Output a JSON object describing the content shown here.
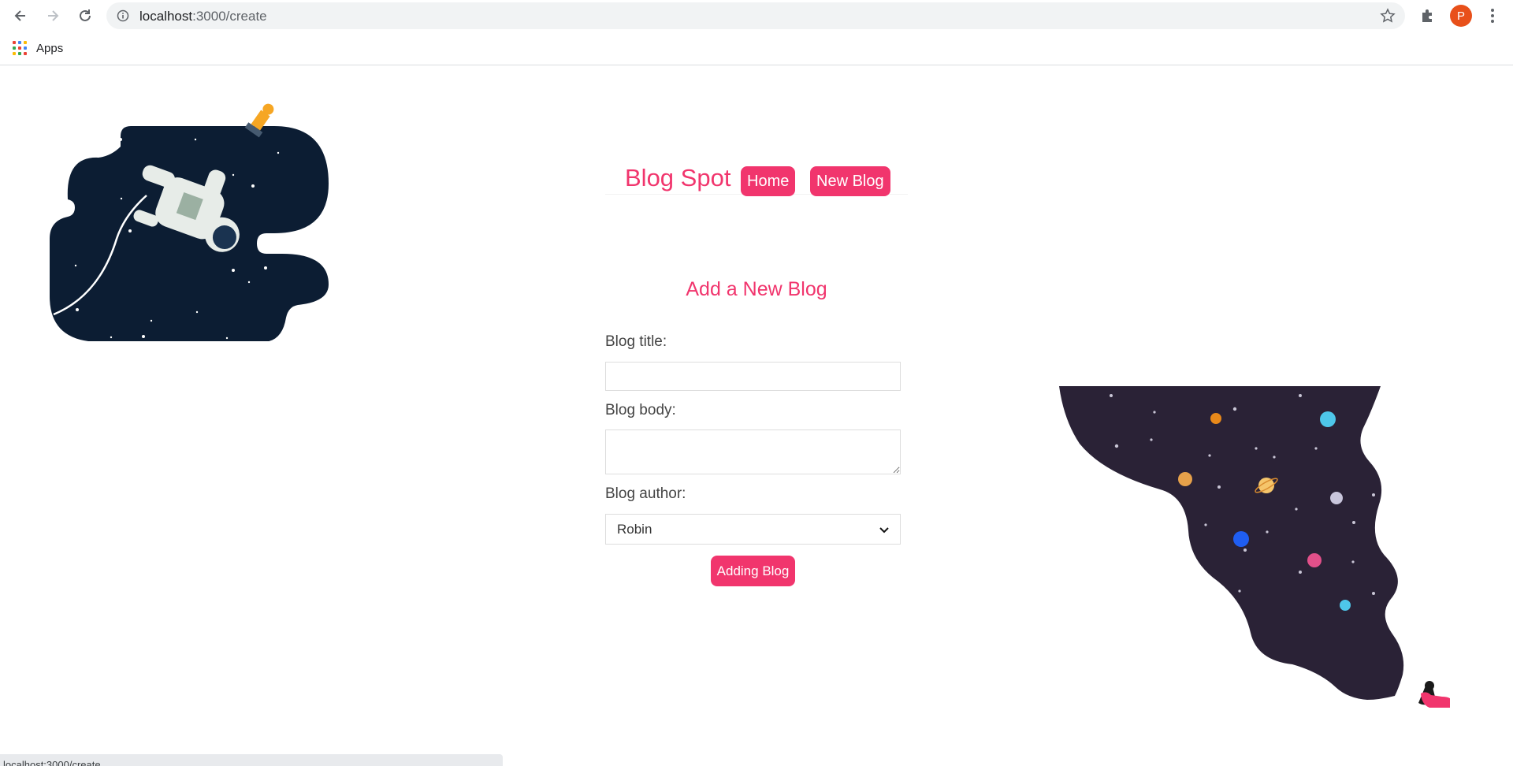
{
  "browser": {
    "url_host": "localhost",
    "url_path": ":3000/create",
    "profile_initial": "P",
    "bookmarks": {
      "apps_label": "Apps"
    },
    "status_url": "localhost:3000/create",
    "icons": [
      "back-icon",
      "forward-icon",
      "reload-icon",
      "info-icon",
      "star-icon",
      "puzzle-icon",
      "menu-dots-icon",
      "apps-grid-icon"
    ],
    "colors": {
      "profile": "#e8501a"
    }
  },
  "navbar": {
    "brand": "Blog Spot",
    "links": [
      {
        "label": "Home"
      },
      {
        "label": "New Blog"
      }
    ]
  },
  "create": {
    "heading": "Add a New Blog",
    "title_label": "Blog title:",
    "title_value": "",
    "body_label": "Blog body:",
    "body_value": "",
    "author_label": "Blog author:",
    "author_selected": "Robin",
    "submit_label": "Adding Blog"
  },
  "theme": {
    "accent": "#f1356d",
    "space_left": "#0c1d33",
    "space_right": "#2a2236"
  }
}
